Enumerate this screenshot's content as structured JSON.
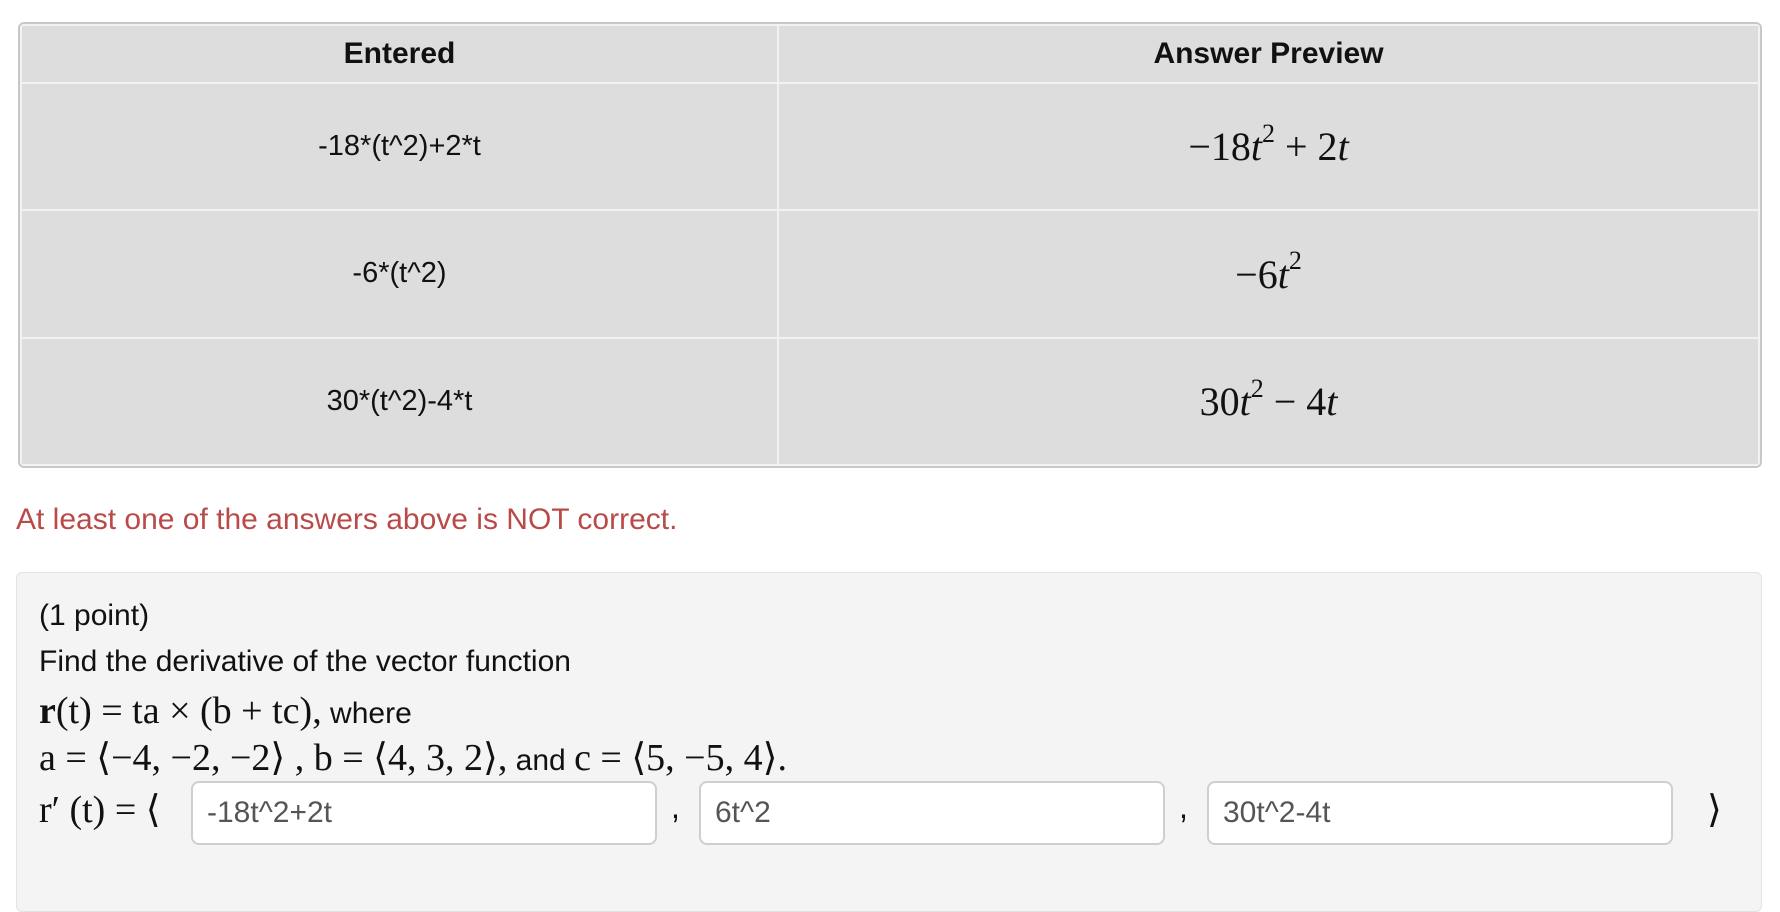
{
  "results_table": {
    "headers": {
      "entered": "Entered",
      "preview": "Answer Preview"
    },
    "rows": [
      {
        "entered": "-18*(t^2)+2*t",
        "preview_a": "−18",
        "preview_var": "t",
        "preview_exp": "2",
        "preview_b": " + 2",
        "preview_var2": "t"
      },
      {
        "entered": "-6*(t^2)",
        "preview_a": "−6",
        "preview_var": "t",
        "preview_exp": "2",
        "preview_b": "",
        "preview_var2": ""
      },
      {
        "entered": "30*(t^2)-4*t",
        "preview_a": "30",
        "preview_var": "t",
        "preview_exp": "2",
        "preview_b": " − 4",
        "preview_var2": "t"
      }
    ]
  },
  "feedback": {
    "message": "At least one of the answers above is NOT correct."
  },
  "problem": {
    "points": "(1 point)",
    "prompt": "Find the derivative of the vector function",
    "function_bold_r": "r",
    "function_rest": "(t) = ta × (b + tc),",
    "where": " where",
    "vectors": "a = ⟨−4, −2, −2⟩ , b = ⟨4, 3, 2⟩,",
    "and_text": " and ",
    "c_vector": "c = ⟨5, −5, 4⟩.",
    "answer_lhs": "r′ (t) = ⟨",
    "answer_rangle": "⟩",
    "answers": [
      {
        "value": "-18t^2+2t"
      },
      {
        "value": "6t^2"
      },
      {
        "value": "30t^2-4t"
      }
    ],
    "separator": ","
  },
  "colors": {
    "feedback": "#b94a48",
    "table_bg": "#dddddd",
    "problem_bg": "#f4f4f4"
  }
}
